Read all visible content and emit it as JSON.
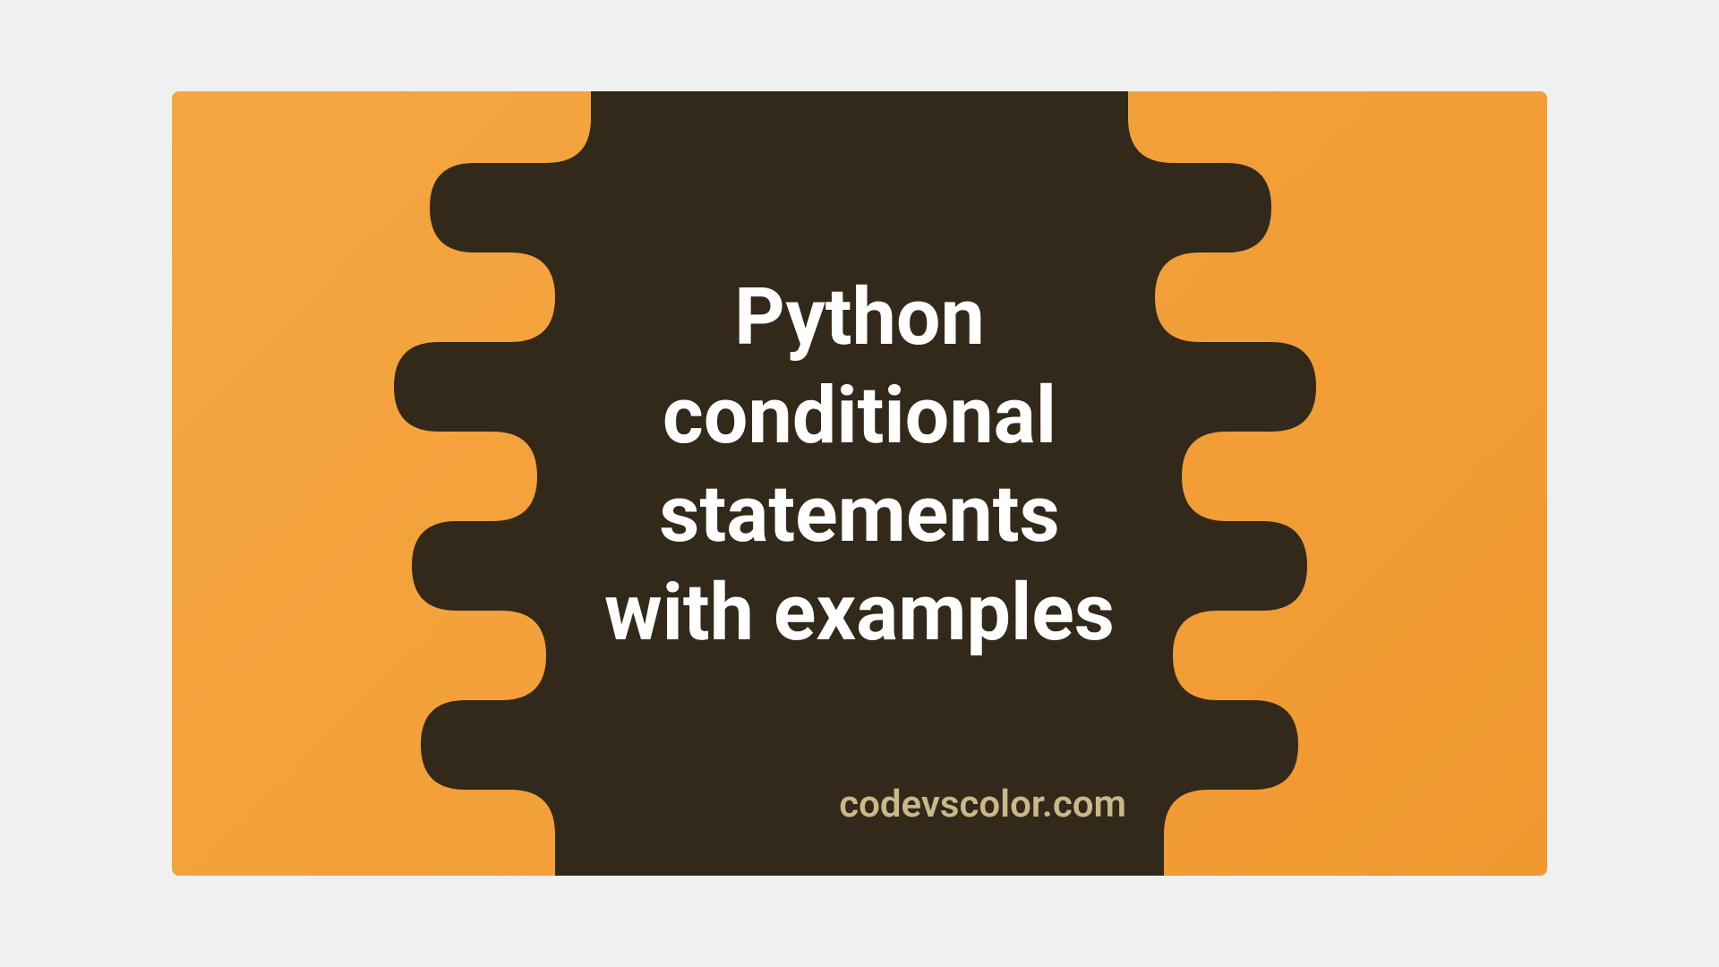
{
  "title_lines": {
    "line1": "Python",
    "line2": "conditional",
    "line3": "statements",
    "line4": "with examples"
  },
  "website": "codevscolor.com",
  "colors": {
    "background_start": "#f5a742",
    "background_end": "#f09830",
    "blob": "#32291a",
    "title_text": "#ffffff",
    "website_text": "#c9b88a"
  }
}
